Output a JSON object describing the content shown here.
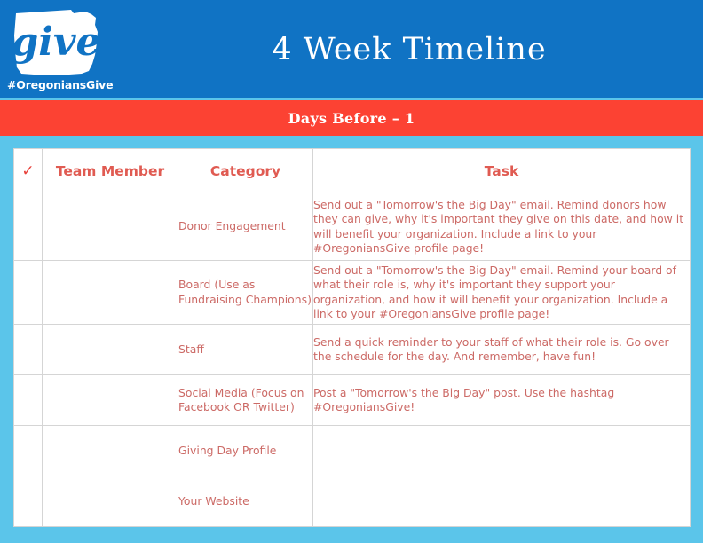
{
  "header": {
    "title": "4 Week Timeline",
    "logo": {
      "wordmark": "give",
      "hashtag": "#OregoniansGive",
      "shape_name": "oregon-state-outline"
    },
    "banner_text": "Days Before – 1",
    "colors": {
      "blue": "#1073c4",
      "red": "#fc4233",
      "cyan": "#5bc5ea",
      "white": "#ffffff",
      "text_salmon": "#cc6a66",
      "heading_salmon": "#e05b52"
    }
  },
  "table": {
    "columns": [
      {
        "key": "check",
        "label": "✓"
      },
      {
        "key": "member",
        "label": "Team Member"
      },
      {
        "key": "category",
        "label": "Category"
      },
      {
        "key": "task",
        "label": "Task"
      }
    ],
    "rows": [
      {
        "check": "",
        "member": "",
        "category": "Donor Engagement",
        "category_sub": "",
        "task": "Send out a \"Tomorrow's the Big Day\" email. Remind donors how they can give, why it's important they give on this date, and how it will benefit your organization. Include a link to your #OregoniansGive profile page!"
      },
      {
        "check": "",
        "member": "",
        "category": "Board ",
        "category_sub": "(Use as Fundraising Champions)",
        "task": "Send out a \"Tomorrow's the Big Day\" email. Remind your board of what their role is, why it's important they support your organization, and how it will benefit your organization. Include a link to your #OregoniansGive profile page!"
      },
      {
        "check": "",
        "member": "",
        "category": "Staff",
        "category_sub": "",
        "task": "Send a quick reminder to your staff of what their role is. Go over the schedule for the day. And remember, have fun!"
      },
      {
        "check": "",
        "member": "",
        "category": "Social Media ",
        "category_sub": "(Focus on Facebook OR Twitter)",
        "task": "Post a \"Tomorrow's the Big Day\" post. Use the hashtag #OregoniansGive!"
      },
      {
        "check": "",
        "member": "",
        "category": "Giving Day Profile",
        "category_sub": "",
        "task": ""
      },
      {
        "check": "",
        "member": "",
        "category": "Your Website",
        "category_sub": "",
        "task": ""
      }
    ]
  }
}
